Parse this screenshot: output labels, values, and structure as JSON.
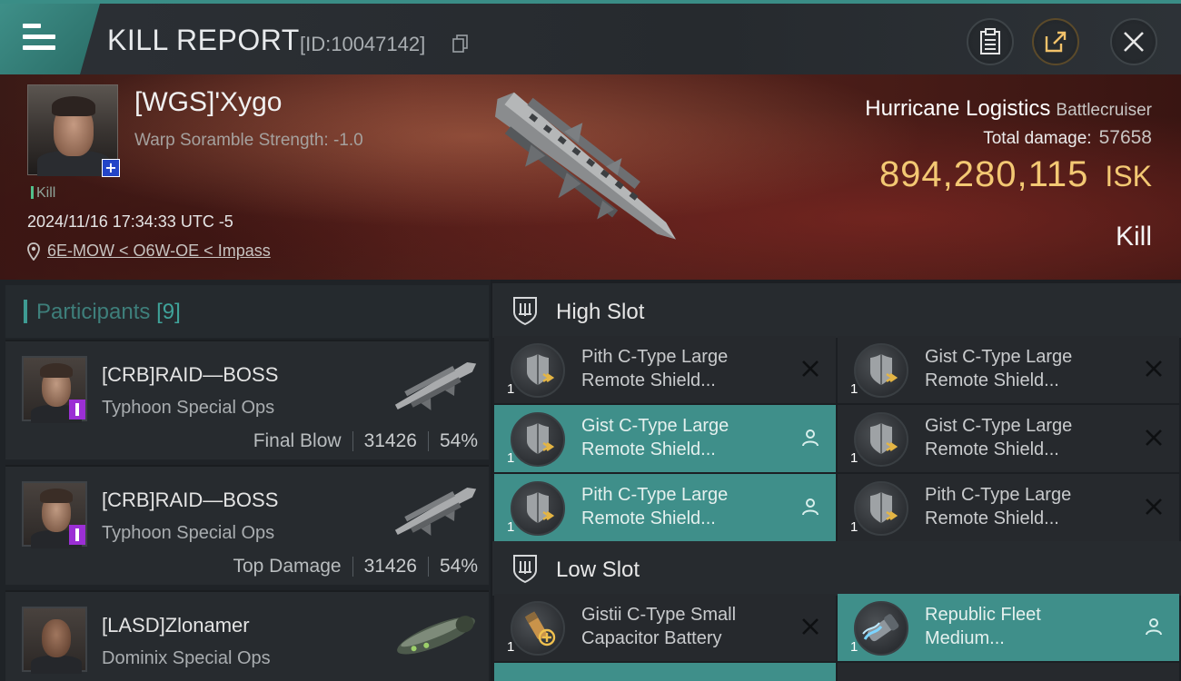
{
  "header": {
    "title": "KILL REPORT",
    "id_label": "[ID:10047142]",
    "buttons": {
      "report": "clipboard-icon",
      "share": "share-icon",
      "close": "close-icon"
    }
  },
  "victim": {
    "name": "[WGS]'Xygo",
    "warp_text": "Warp Soramble Strength: -1.0",
    "kill_tag": "Kill",
    "timestamp": "2024/11/16 17:34:33 UTC -5",
    "location": "6E-MOW < O6W-OE < Impass",
    "ship": "Hurricane Logistics",
    "ship_class": "Battlecruiser",
    "total_damage_label": "Total damage:",
    "total_damage": "57658",
    "isk_value": "894,280,115",
    "isk_unit": "ISK",
    "result": "Kill"
  },
  "participants": {
    "label": "Participants",
    "count": "[9]",
    "items": [
      {
        "name": "[CRB]RAID—BOSS",
        "ship": "Typhoon Special Ops",
        "role": "Final Blow",
        "damage": "31426",
        "percent": "54%"
      },
      {
        "name": "[CRB]RAID—BOSS",
        "ship": "Typhoon Special Ops",
        "role": "Top Damage",
        "damage": "31426",
        "percent": "54%"
      },
      {
        "name": "[LASD]Zlonamer",
        "ship": "Dominix Special Ops",
        "role": "",
        "damage": "",
        "percent": ""
      }
    ]
  },
  "fitting": {
    "high_slot_label": "High Slot",
    "low_slot_label": "Low Slot",
    "high": [
      {
        "line1": "Pith C-Type Large",
        "line2": "Remote Shield...",
        "qty": "1",
        "state": "destroyed"
      },
      {
        "line1": "Gist C-Type Large",
        "line2": "Remote Shield...",
        "qty": "1",
        "state": "destroyed"
      },
      {
        "line1": "Gist C-Type Large",
        "line2": "Remote Shield...",
        "qty": "1",
        "state": "dropped"
      },
      {
        "line1": "Gist C-Type Large",
        "line2": "Remote Shield...",
        "qty": "1",
        "state": "destroyed"
      },
      {
        "line1": "Pith C-Type Large",
        "line2": "Remote Shield...",
        "qty": "1",
        "state": "dropped"
      },
      {
        "line1": "Pith C-Type Large",
        "line2": "Remote Shield...",
        "qty": "1",
        "state": "destroyed"
      }
    ],
    "low": [
      {
        "line1": "Gistii C-Type Small",
        "line2": "Capacitor Battery",
        "qty": "1",
        "state": "destroyed"
      },
      {
        "line1": "Republic Fleet",
        "line2": "Medium...",
        "qty": "1",
        "state": "dropped"
      }
    ]
  },
  "colors": {
    "accent_teal": "#3f8f8a",
    "isk_gold": "#f3c873",
    "kill_green": "#52c08b"
  }
}
